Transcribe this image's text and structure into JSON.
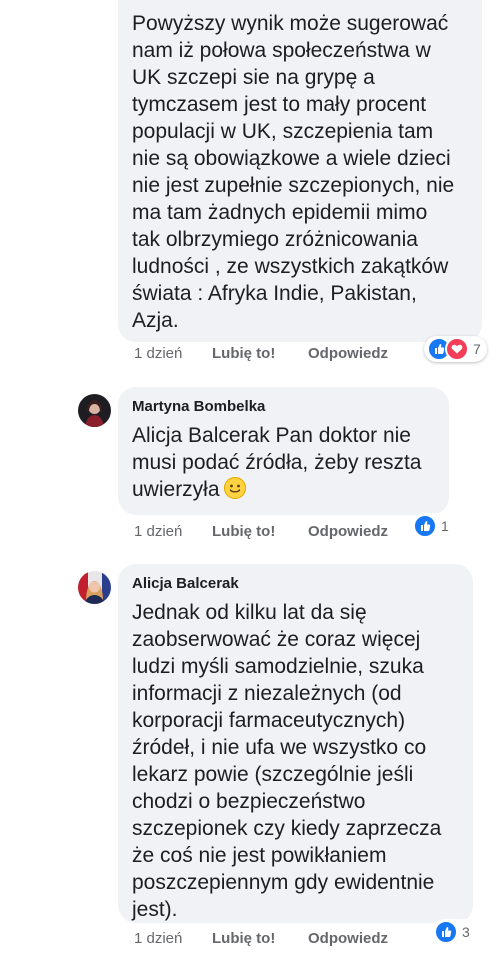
{
  "comments": [
    {
      "author": "",
      "text": "Powyższy wynik może sugerować\nnam iż połowa społeczeństwa w\nUK szczepi sie na grypę a\ntymczasem jest to mały procent\npopulacji w UK, szczepienia tam\nnie są obowiązkowe a wiele dzieci\nnie jest zupełnie szczepionych, nie\nma tam żadnych epidemii mimo\ntak olbrzymiego zróżnicowania\nludności ,  ze wszystkich zakątków\nświata : Afryka Indie, Pakistan,\nAzja.",
      "time": "1 dzień",
      "like": "Lubię to!",
      "reply": "Odpowiedz",
      "reaction_count": "7",
      "reaction_icons": [
        "like-icon",
        "love-icon"
      ]
    },
    {
      "author": "Martyna Bombelka",
      "text": "Alicja Balcerak Pan doktor nie\nmusi podać źródła, żeby reszta\nuwierzyła",
      "time": "1 dzień",
      "like": "Lubię to!",
      "reply": "Odpowiedz",
      "reaction_count": "1",
      "reaction_icons": [
        "like-icon"
      ]
    },
    {
      "author": "Alicja Balcerak",
      "text": "Jednak od kilku lat da się\nzaobserwować że coraz więcej\nludzi myśli samodzielnie, szuka\ninformacji z niezależnych (od\nkorporacji farmaceutycznych)\nźródeł, i nie ufa we wszystko co\nlekarz powie (szczególnie jeśli\nchodzi o bezpieczeństwo\nszczepionek czy kiedy zaprzecza\nże coś nie jest powikłaniem\nposzczepiennym gdy ewidentnie\njest).",
      "time": "1 dzień",
      "like": "Lubię to!",
      "reply": "Odpowiedz",
      "reaction_count": "3",
      "reaction_icons": [
        "like-icon"
      ]
    }
  ],
  "colors": {
    "bubble": "#f0f2f5",
    "text": "#1c1e21",
    "meta": "#65676b",
    "like_blue": "#1877f2",
    "love_red": "#f33e58"
  }
}
